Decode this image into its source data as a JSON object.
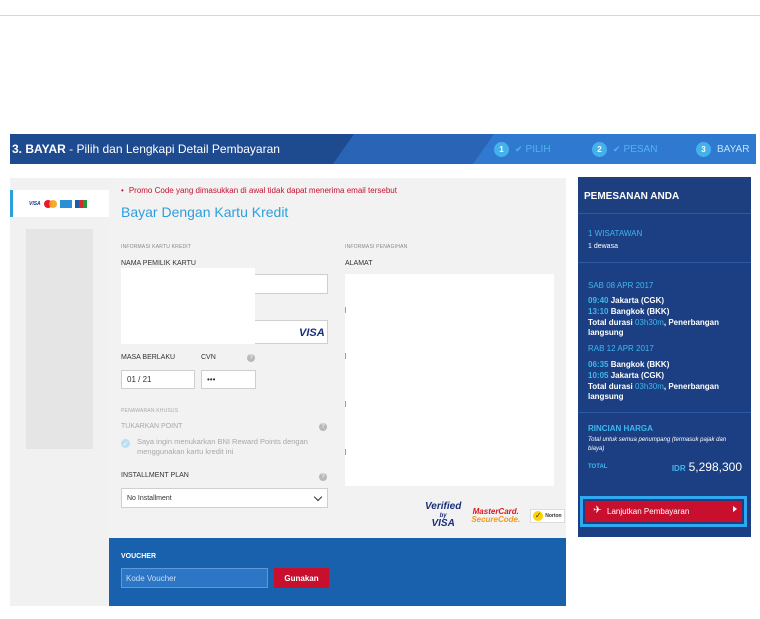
{
  "header": {
    "step_prefix": "3. BAYAR",
    "title_rest": " - Pilih dan Lengkapi Detail Pembayaran",
    "steps": [
      {
        "num": "1",
        "label": "PILIH"
      },
      {
        "num": "2",
        "label": "PESAN"
      },
      {
        "num": "3",
        "label": "BAYAR"
      }
    ]
  },
  "card_tab": {
    "icons": [
      "visa-icon",
      "mastercard-icon",
      "amex-icon",
      "jcb-icon"
    ],
    "visa_text": "VISA"
  },
  "form": {
    "promo_note": "Promo Code yang dimasukkan di awal tidak dapat menerima email tersebut",
    "title": "Bayar Dengan Kartu Kredit",
    "card_info_label": "INFORMASI KARTU KREDIT",
    "billing_info_label": "INFORMASI PENAGIHAN",
    "cardholder_label": "NAMA PEMILIK KARTU",
    "address_label": "ALAMAT",
    "card_brand": "VISA",
    "expiry_label": "MASA BERLAKU",
    "cvn_label": "CVN",
    "expiry_value": "01 / 21",
    "cvn_value": "•••",
    "special_offer_label": "PENAWARAN KHUSUS",
    "redeem_label": "TUKARKAN POINT",
    "redeem_text": "Saya ingin menukarkan BNI Reward Points dengan menggunakan kartu kredit ini",
    "installment_label": "INSTALLMENT PLAN",
    "installment_value": "No Installment"
  },
  "logos": {
    "verified_top": "Verified",
    "verified_by": "by",
    "verified_visa": "VISA",
    "mc_top": "MasterCard.",
    "mc_bottom": "SecureCode.",
    "norton": "Norton"
  },
  "voucher": {
    "title": "VOUCHER",
    "placeholder": "Kode Voucher",
    "button": "Gunakan"
  },
  "summary": {
    "title": "PEMESANAN ANDA",
    "travelers": "1 WISATAWAN",
    "adults": "1 dewasa",
    "leg1_date": "SAB 08 APR 2017",
    "leg1_dep_time": "09:40",
    "leg1_dep_city": "Jakarta (CGK)",
    "leg1_arr_time": "13:10",
    "leg1_arr_city": "Bangkok (BKK)",
    "leg1_total_prefix": "Total durasi ",
    "leg1_duration": "03h30m",
    "leg1_total_suffix": ", Penerbangan langsung",
    "leg2_date": "RAB 12 APR 2017",
    "leg2_dep_time": "06:35",
    "leg2_dep_city": "Bangkok (BKK)",
    "leg2_arr_time": "10:05",
    "leg2_arr_city": "Jakarta (CGK)",
    "leg2_total_prefix": "Total durasi ",
    "leg2_duration": "03h30m",
    "leg2_total_suffix": ", Penerbangan langsung",
    "price_title": "RINCIAN HARGA",
    "price_note": "Total untuk semua penumpang (termasuk pajak dan biaya)",
    "total_label": "TOTAL",
    "currency": "IDR",
    "total_value": "5,298,300",
    "continue_button": "Lanjutkan Pembayaran"
  },
  "colors": {
    "brand_blue": "#1e4a8f",
    "accent_cyan": "#2e9fdd",
    "action_red": "#c8102e",
    "voucher_blue": "#1960ad"
  }
}
